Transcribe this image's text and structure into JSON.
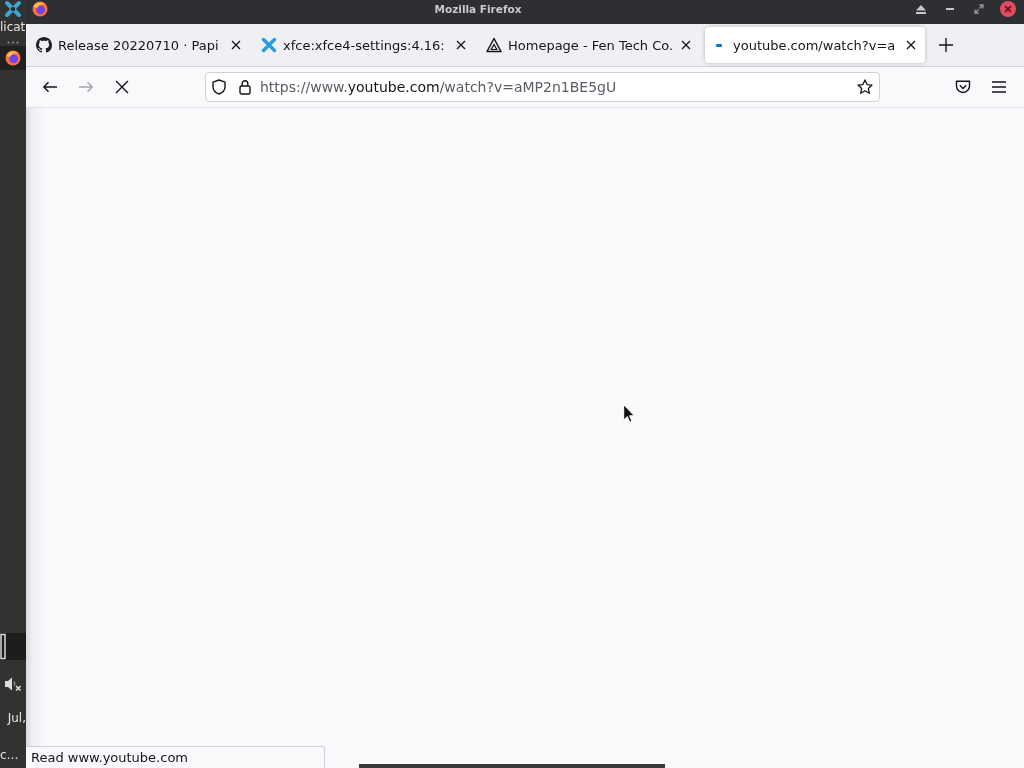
{
  "panel": {
    "menu_label": "licat",
    "volume": {
      "muted": true
    },
    "clock_lines": [
      "Jul,",
      "c…"
    ]
  },
  "window": {
    "title": "Mozilla Firefox"
  },
  "tabs": [
    {
      "label": "Release 20220710 · Papi",
      "selected": false,
      "loading": false
    },
    {
      "label": "xfce:xfce4-settings:4.16:",
      "selected": false,
      "loading": false
    },
    {
      "label": "Homepage - Fen Tech Co.",
      "selected": false,
      "loading": false
    },
    {
      "label": "youtube.com/watch?v=a",
      "selected": true,
      "loading": true
    }
  ],
  "navigation": {
    "back_disabled": false,
    "forward_disabled": true,
    "loading": true
  },
  "address_bar": {
    "prefix": "https://www.",
    "domain": "youtube.com",
    "path": "/watch?v=aMP2n1BE5gU",
    "bookmarked": false
  },
  "status_text": "Read www.youtube.com"
}
